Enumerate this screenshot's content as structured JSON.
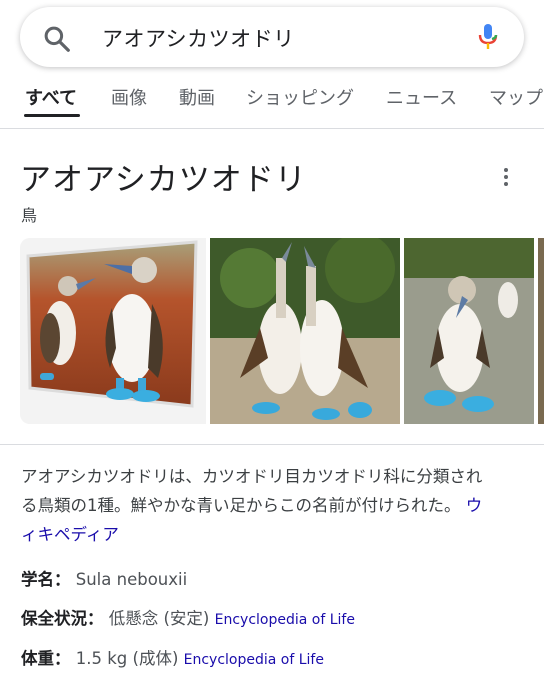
{
  "search": {
    "query": "アオアシカツオドリ"
  },
  "tabs": [
    {
      "label": "すべて",
      "active": true
    },
    {
      "label": "画像"
    },
    {
      "label": "動画"
    },
    {
      "label": "ショッピング"
    },
    {
      "label": "ニュース"
    },
    {
      "label": "マップ"
    }
  ],
  "panel": {
    "title": "アオアシカツオドリ",
    "subtitle": "鳥",
    "images": [
      {
        "name": "blue-footed-booby-pair-on-red-rocks"
      },
      {
        "name": "blue-footed-booby-courtship-display"
      },
      {
        "name": "blue-footed-booby-standing"
      }
    ],
    "description_lines": [
      "アオアシカツオドリは、カツオドリ目カツオドリ科に分類され",
      "る鳥類の1種。鮮やかな青い足からこの名前が付けられた。"
    ],
    "description_link": "ウィキペディア",
    "description_link_line1": "ウ",
    "description_link_line2": "ィキペディア",
    "facts": [
      {
        "label": "学名",
        "value": "Sula nebouxii",
        "source": ""
      },
      {
        "label": "保全状況",
        "value": "低懸念 (安定)",
        "source": "Encyclopedia of Life"
      },
      {
        "label": "体重",
        "value": "1.5 kg (成体)",
        "source": "Encyclopedia of Life"
      }
    ],
    "fact_separator": "：",
    "colors": {
      "link": "#1a0dab",
      "mic_blue": "#4285f4",
      "mic_red": "#ea4335",
      "mic_yellow": "#fbbc04",
      "mic_green": "#34a853"
    }
  }
}
